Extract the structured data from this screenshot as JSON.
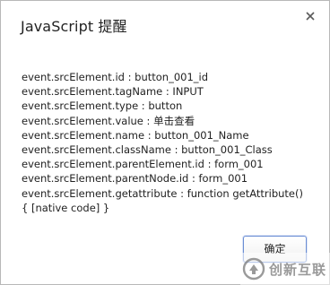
{
  "dialog": {
    "title": "JavaScript 提醒",
    "close_icon": "close-icon",
    "lines": [
      "event.srcElement.id : button_001_id",
      "event.srcElement.tagName : INPUT",
      "event.srcElement.type : button",
      "event.srcElement.value : 单击查看",
      "event.srcElement.name : button_001_Name",
      "event.srcElement.className : button_001_Class",
      "event.srcElement.parentElement.id : form_001",
      "event.srcElement.parentNode.id : form_001",
      "event.srcElement.getattribute : function getAttribute()",
      "{ [native code] }"
    ],
    "ok_label": "确定"
  },
  "watermark": {
    "text": "创新互联",
    "logo_icon": "brand-logo-icon"
  },
  "colors": {
    "button_border": "#6b8ed4",
    "text": "#222222",
    "watermark": "#787878"
  }
}
